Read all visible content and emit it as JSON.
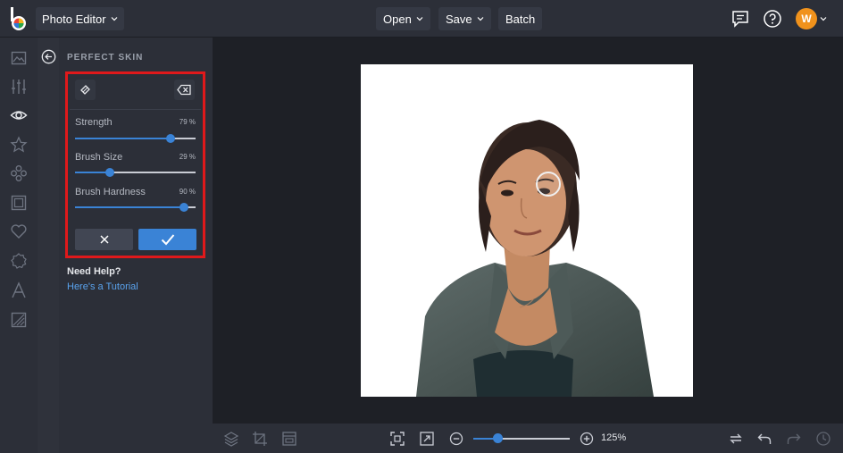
{
  "topbar": {
    "app_name": "Photo Editor",
    "open_label": "Open",
    "save_label": "Save",
    "batch_label": "Batch",
    "avatar_initial": "W"
  },
  "panel": {
    "title": "PERFECT SKIN",
    "sliders": [
      {
        "label": "Strength",
        "value_text": "79 %",
        "value": 79
      },
      {
        "label": "Brush Size",
        "value_text": "29 %",
        "value": 29
      },
      {
        "label": "Brush Hardness",
        "value_text": "90 %",
        "value": 90
      }
    ],
    "help_title": "Need Help?",
    "help_link": "Here's a Tutorial"
  },
  "zoom": {
    "value_text": "125%",
    "level": 0.25
  },
  "colors": {
    "accent": "#3a83d6",
    "highlight_border": "#e0191b",
    "avatar": "#f0921c",
    "background": "#23252d"
  }
}
